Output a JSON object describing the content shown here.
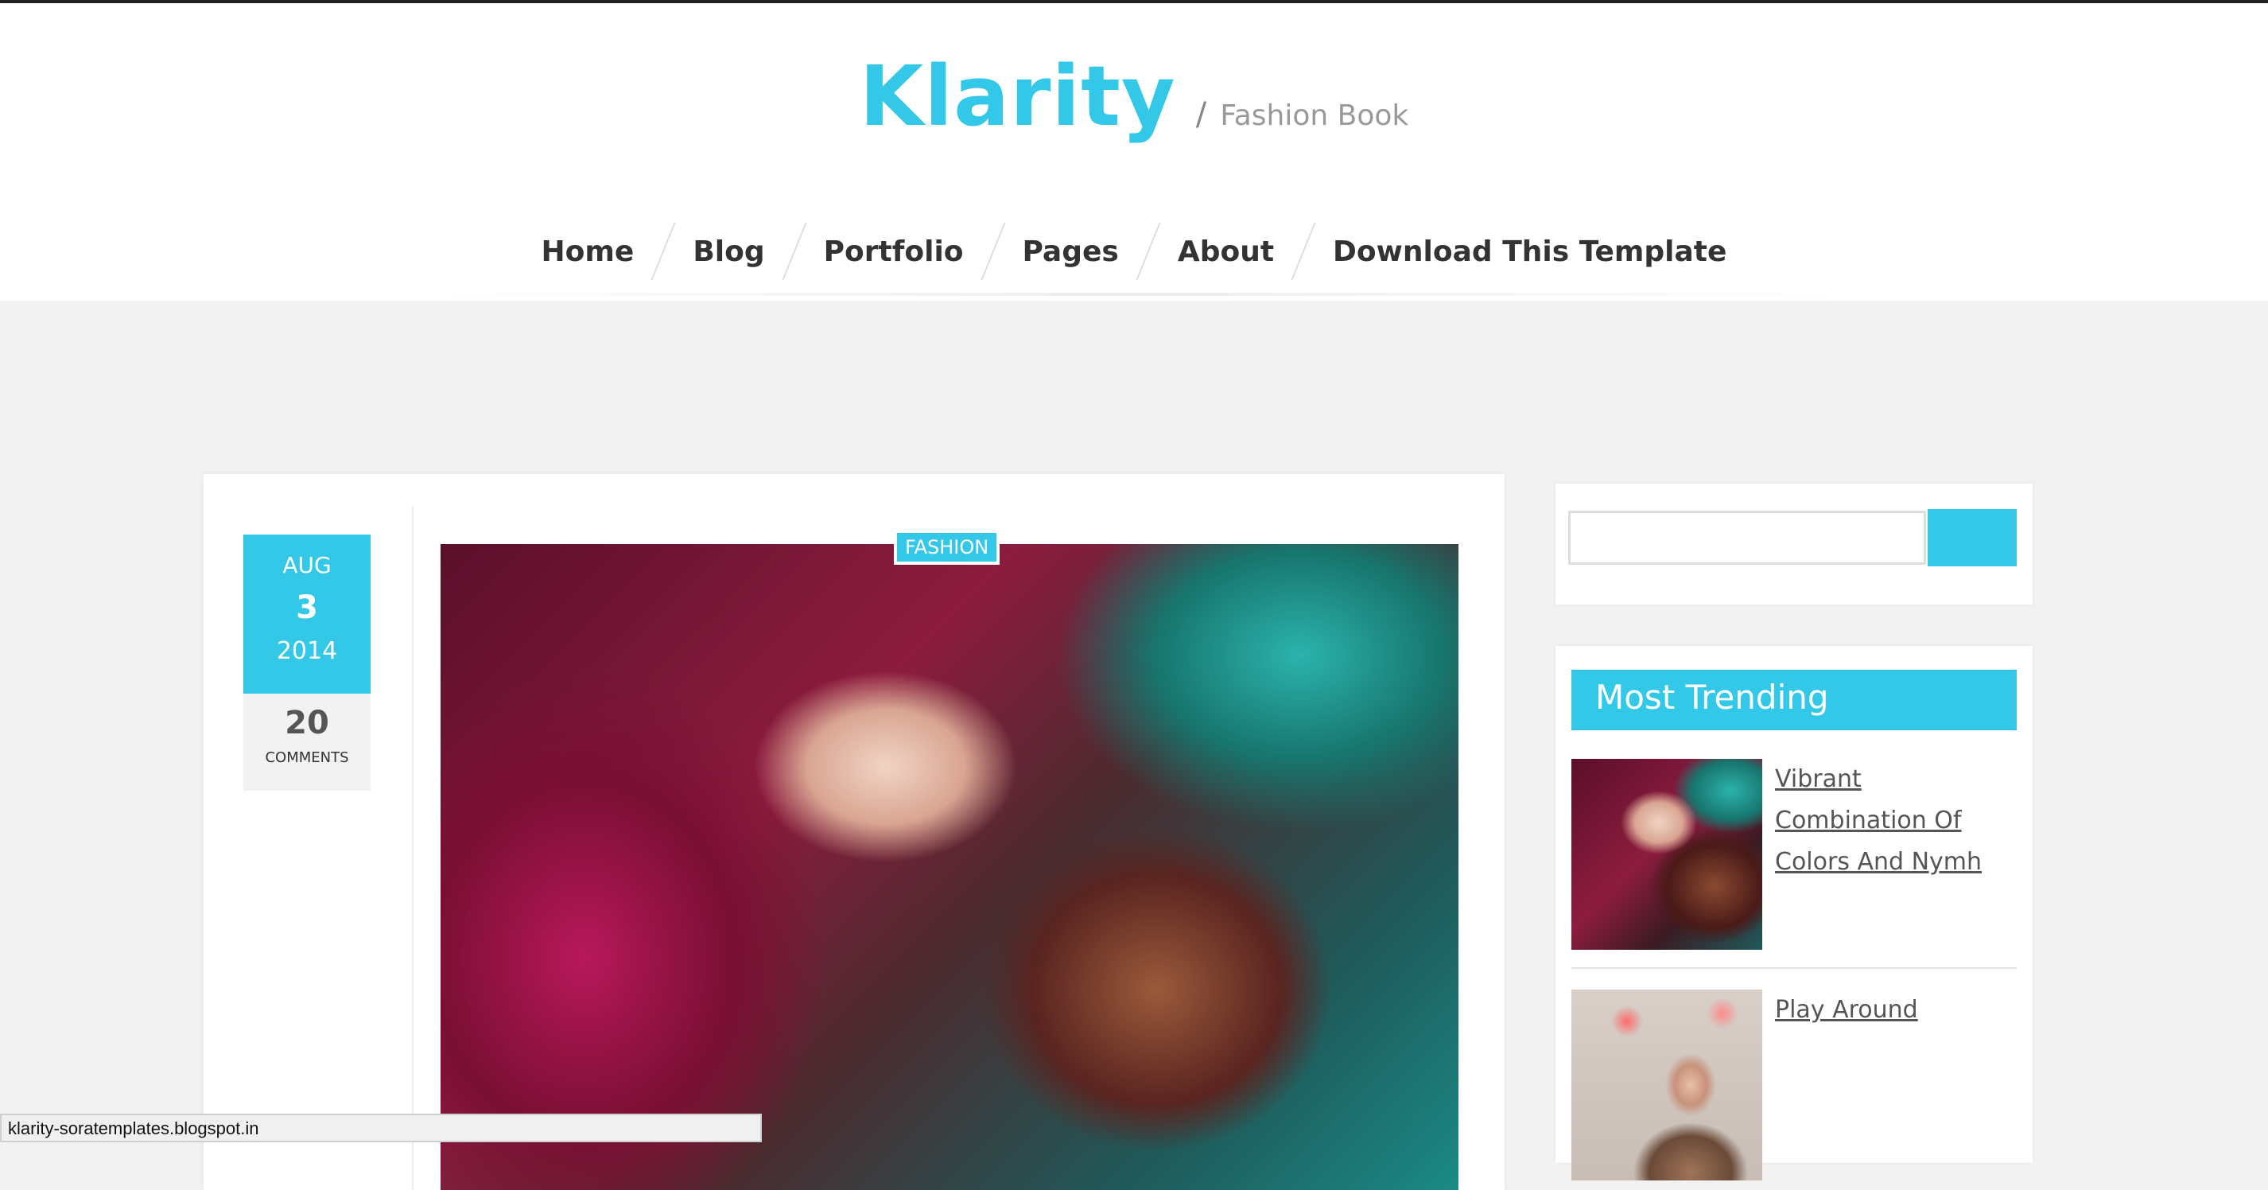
{
  "header": {
    "logo": "Klarity",
    "separator": "/",
    "tagline": "Fashion Book"
  },
  "nav": {
    "items": [
      {
        "label": "Home"
      },
      {
        "label": "Blog"
      },
      {
        "label": "Portfolio"
      },
      {
        "label": "Pages"
      },
      {
        "label": "About"
      },
      {
        "label": "Download This Template"
      }
    ]
  },
  "post": {
    "date": {
      "month": "AUG",
      "day": "3",
      "year": "2014"
    },
    "comments": {
      "count": "20",
      "label": "COMMENTS"
    },
    "category": "FASHION"
  },
  "sidebar": {
    "trending_title": "Most Trending",
    "trending_items": [
      {
        "title": "Vibrant Combination Of Colors And Nymh"
      },
      {
        "title": "Play Around"
      }
    ]
  },
  "status": {
    "url": "klarity-soratemplates.blogspot.in"
  },
  "colors": {
    "accent": "#33c8e8"
  }
}
